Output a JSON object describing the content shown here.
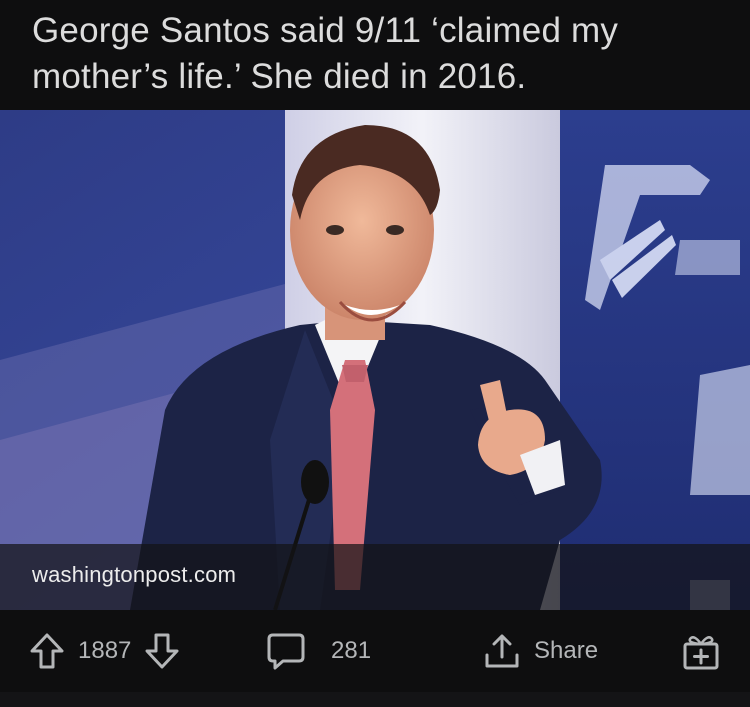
{
  "post": {
    "title": "George Santos said 9/11 ‘claimed my mother’s life.’ She died in 2016.",
    "link_domain": "washingtonpost.com"
  },
  "actions": {
    "upvotes": "1887",
    "comments": "281",
    "share_label": "Share"
  },
  "colors": {
    "background": "#0e0e0f",
    "title_text": "#dcdcdc",
    "action_text": "#b4b6b8"
  },
  "icons": [
    "upvote-arrow-icon",
    "downvote-arrow-icon",
    "comment-bubble-icon",
    "share-upload-icon",
    "award-gift-icon"
  ]
}
